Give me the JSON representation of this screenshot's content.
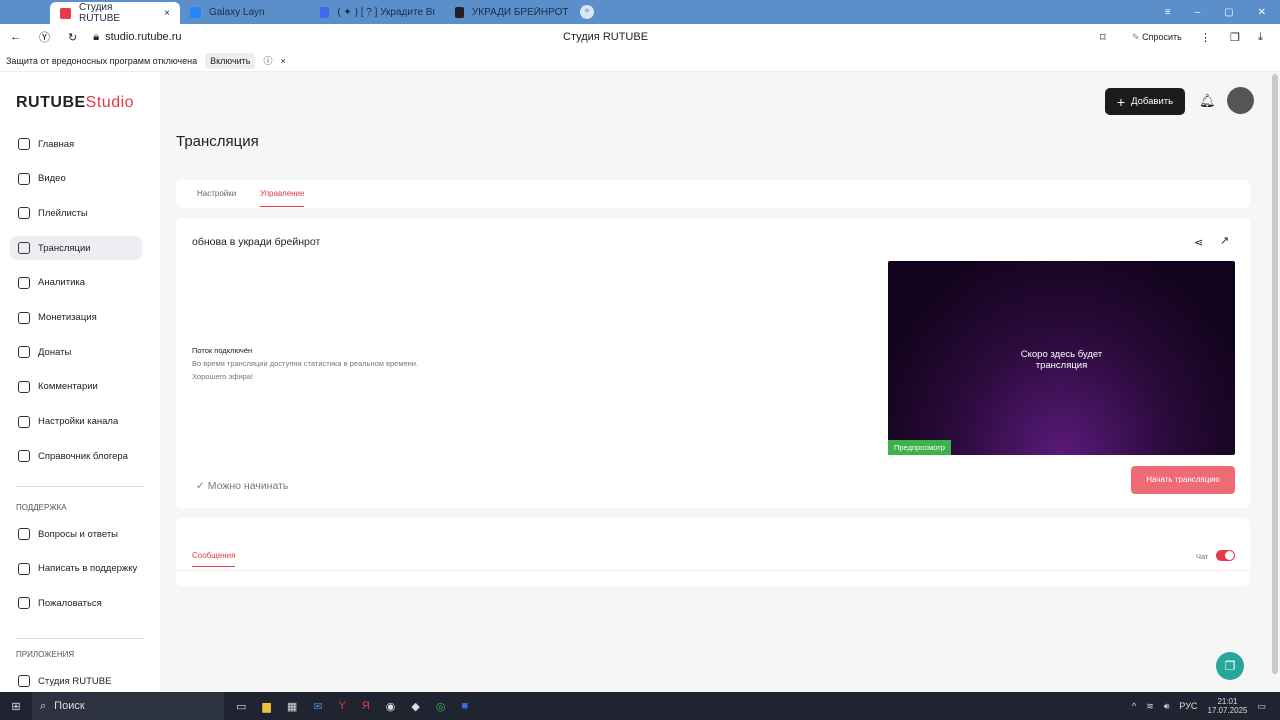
{
  "browser": {
    "tabs": [
      {
        "label": "Студия RUTUBE",
        "color": "#e6394a"
      },
      {
        "label": "Galaxy Layn",
        "color": "#2787f5"
      },
      {
        "label": "( ✦ ) [ ? ] Украдите Brainr",
        "color": "#3a6ee8"
      },
      {
        "label": "УКРАДИ БРЕЙНРОТ 🔥 А",
        "color": "#222"
      }
    ],
    "url": "studio.rutube.ru",
    "page_title": "Студия RUTUBE",
    "ask": "Спросить",
    "info": "Защита от вредоносных программ отключена",
    "enable": "Включить"
  },
  "logo": {
    "brand": "RUTUBE",
    "studio": "Studio"
  },
  "sidebar": {
    "items": [
      "Главная",
      "Видео",
      "Плейлисты",
      "Трансляции",
      "Аналитика",
      "Монетизация",
      "Донаты",
      "Комментарии",
      "Настройки канала",
      "Справочник блогера"
    ],
    "support_title": "ПОДДЕРЖКА",
    "support": [
      "Вопросы и ответы",
      "Написать в поддержку",
      "Пожаловаться"
    ],
    "apps_title": "ПРИЛОЖЕНИЯ",
    "apps": [
      "Студия RUTUBE"
    ]
  },
  "header": {
    "add": "Добавить"
  },
  "page": {
    "title": "Трансляция",
    "tabs": [
      "Настройки",
      "Управление"
    ],
    "stream_title": "обнова в укради брейнрот",
    "status_title": "Поток подключён",
    "status_text": "Во время трансляции доступна статистика в реальном времени.",
    "status_wish": "Хорошего эфира!",
    "ready": "Можно начинать",
    "preview_text": "Скоро здесь будет трансляция",
    "preview_badge": "Предпросмотр",
    "start": "Начать трансляцию",
    "messages_tab": "Сообщения",
    "chat": "Чат",
    "chat_on": true
  },
  "taskbar": {
    "search": "Поиск",
    "lang": "РУС",
    "time": "21:01",
    "date": "17.07.2025"
  }
}
